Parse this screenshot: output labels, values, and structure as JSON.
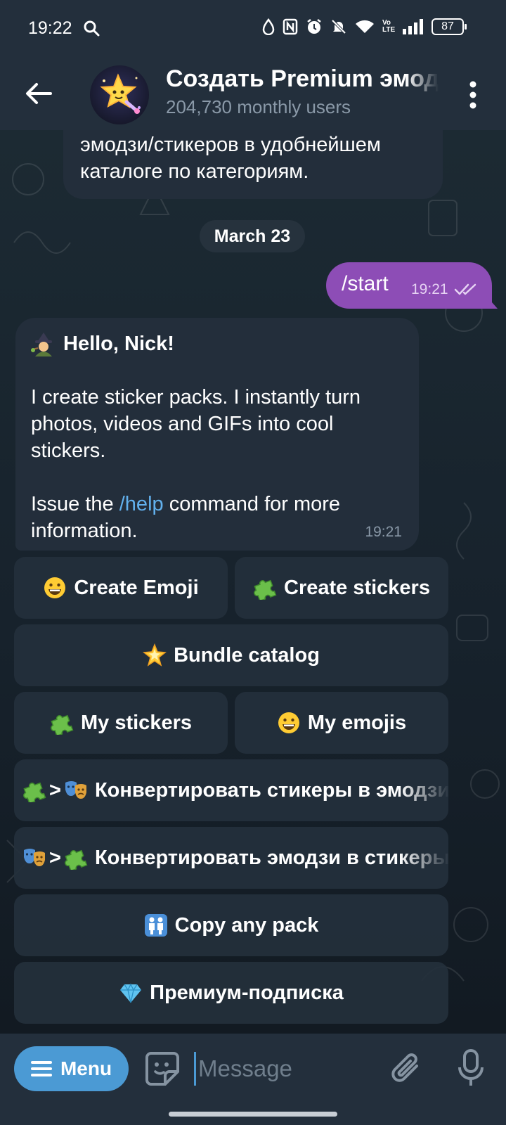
{
  "status_bar": {
    "time": "19:22",
    "battery": "87",
    "network_label": "Vo LTE",
    "icons": [
      "search-icon",
      "drop-icon",
      "nfc-icon",
      "alarm-icon",
      "dnd-icon",
      "wifi-icon",
      "volte-icon",
      "signal-icon",
      "battery-icon"
    ]
  },
  "header": {
    "title": "Создать Premium эмодзи",
    "subtitle": "204,730 monthly users"
  },
  "messages": {
    "previous_text_line1": "эмодзи/стикеров в удобнейшем",
    "previous_text_line2": "каталоге по категориям.",
    "date": "March 23",
    "outgoing": {
      "text": "/start",
      "time": "19:21"
    },
    "welcome": {
      "greeting": "Hello, Nick!",
      "line1": "I create sticker packs. I instantly turn",
      "line2": "photos, videos and GIFs into cool",
      "line3": "stickers.",
      "help_prefix": "Issue the ",
      "help_link": "/help",
      "help_suffix": " command for more",
      "help_line2": "information.",
      "time": "19:21"
    }
  },
  "keyboard": {
    "create_emoji": "Create Emoji",
    "create_stickers": "Create stickers",
    "bundle_catalog": "Bundle catalog",
    "my_stickers": "My stickers",
    "my_emojis": "My emojis",
    "convert_sticker_to_emoji": "Конвертировать стикеры в эмодзи",
    "convert_emoji_to_sticker": "Конвертировать эмодзи в стикеры",
    "copy_pack": "Copy any pack",
    "premium": "Премиум-подписка",
    "arrow": ">"
  },
  "input": {
    "menu_label": "Menu",
    "placeholder": "Message"
  },
  "colors": {
    "header_bg": "#232f3c",
    "bubble_in": "#232e3b",
    "bubble_out": "#8d4db6",
    "accent": "#4b9ad4",
    "link": "#62b1ee"
  }
}
